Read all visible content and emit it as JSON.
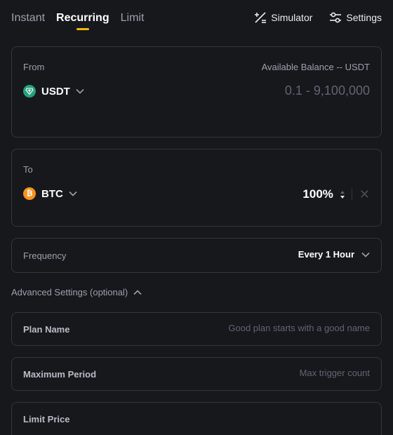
{
  "tabs": [
    {
      "label": "Instant",
      "active": false
    },
    {
      "label": "Recurring",
      "active": true
    },
    {
      "label": "Limit",
      "active": false
    }
  ],
  "actions": {
    "simulator_label": "Simulator",
    "settings_label": "Settings"
  },
  "from": {
    "label": "From",
    "balance_text": "Available Balance -- USDT",
    "coin": "USDT",
    "coin_icon": "tether-icon",
    "amount_placeholder": "0.1 - 9,100,000"
  },
  "to": {
    "label": "To",
    "coin": "BTC",
    "coin_icon": "bitcoin-icon",
    "percent": "100%"
  },
  "frequency": {
    "label": "Frequency",
    "value": "Every 1 Hour"
  },
  "advanced": {
    "label": "Advanced Settings (optional)"
  },
  "plan_name": {
    "label": "Plan Name",
    "placeholder": "Good plan starts with a good name"
  },
  "maximum_period": {
    "label": "Maximum Period",
    "placeholder": "Max trigger count"
  },
  "limit_price": {
    "label": "Limit Price"
  },
  "colors": {
    "background": "#17181c",
    "border": "#33363d",
    "accent": "#f0b90b",
    "usdt": "#26a17b",
    "btc": "#f7931a"
  }
}
